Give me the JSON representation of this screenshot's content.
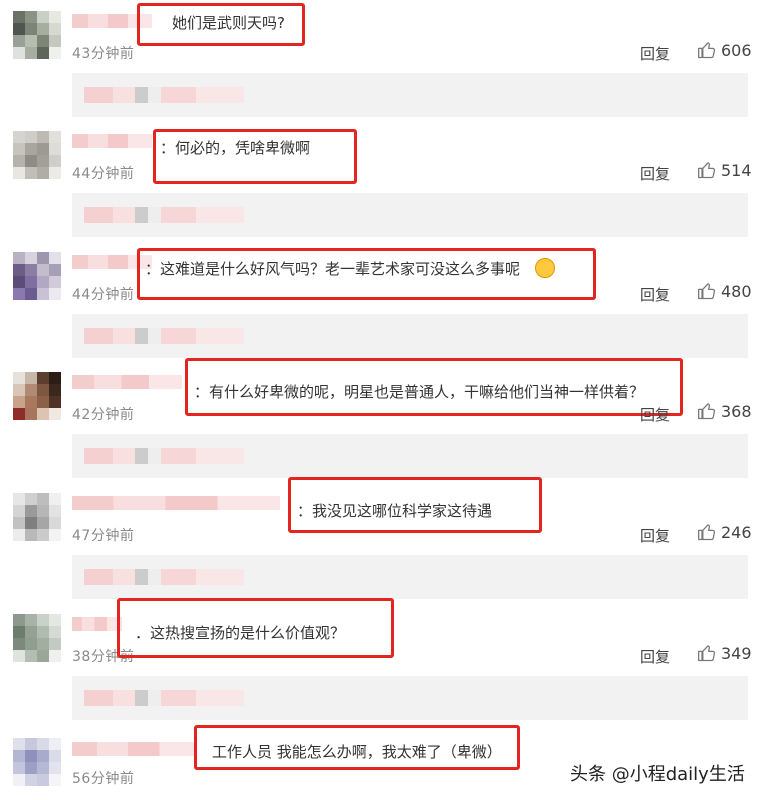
{
  "reply_label": "回复",
  "comments": [
    {
      "text": "她们是武则天吗?",
      "time": "43分钟前",
      "likes": "606"
    },
    {
      "text": "：何必的，凭啥卑微啊",
      "time": "44分钟前",
      "likes": "514"
    },
    {
      "text": "：这难道是什么好风气吗？老一辈艺术家可没这么多事呢",
      "time": "44分钟前",
      "likes": "480"
    },
    {
      "text": "：有什么好卑微的呢，明星也是普通人，干嘛给他们当神一样供着？",
      "time": "42分钟前",
      "likes": "368"
    },
    {
      "text": "：我没见这哪位科学家这待遇",
      "time": "47分钟前",
      "likes": "246"
    },
    {
      "text": "．这热搜宣扬的是什么价值观？",
      "time": "38分钟前",
      "likes": "349"
    },
    {
      "text": "工作人员 我能怎么办啊，我太难了（卑微）",
      "time": "56分钟前",
      "likes": ""
    }
  ],
  "watermark": "头条 @小程daily生活",
  "colors": {
    "highlight_box": "#e32421",
    "sub_reply_bg": "#f2f2f2"
  }
}
